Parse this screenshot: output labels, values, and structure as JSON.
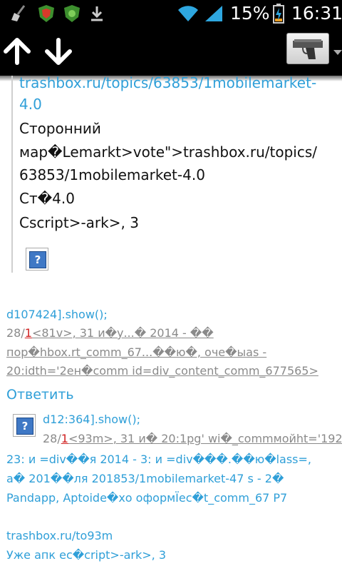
{
  "status_bar": {
    "battery_percent": "15%",
    "time": "16:31",
    "icons": [
      "broom-icon",
      "shield-red-icon",
      "shield-green-icon",
      "download-icon",
      "wifi-icon",
      "signal-icon",
      "battery-icon"
    ]
  },
  "toolbar": {
    "up_icon": "arrow-up-icon",
    "down_icon": "arrow-down-icon",
    "menu_icon": "pistol-icon"
  },
  "post": {
    "lines": [
      "trashbox.ru/topics/63853/1mobilemarket-",
      "4.0",
      "Сторонний",
      "мар�Lemarkt>vote\">trashbox.ru/topics/",
      "63853/1mobilemarket-4.0",
      "Ст�4.0",
      "Cscript>-ark>, 3"
    ]
  },
  "comment1": {
    "line1": "d107424].show();",
    "line2_a": "28/",
    "line2_b": "1",
    "line2_c": "<81v>",
    "line2_d": ", 31 и�у...� 2014 - ��",
    "line3": "пор�hbox.rt_comm_67...��ю�, оче�ыas -",
    "line4": "20:idth='2ен�comm id=div_content_comm_677565>",
    "reply": "Ответить"
  },
  "comment2": {
    "line1": "d12:364].show();",
    "line2_a": "28/",
    "line2_b": "1",
    "line2_c": "<93m>",
    "line2_d": ", 31 и� 20:1pg' wi�_commмойht='192",
    "line3": "23: и =div��я 2014 - 3: и =div���.��ю�lass=,",
    "line4": "а� 201��ля 201853/1mobilemarket-47  s - 2�",
    "line5": "Pandapp, Aptoide�хо оформЇес�t_comm_67 P7",
    "line6": "trashbox.ru/to93m",
    "line7": "Уже апк ес�cript>-ark>, 3"
  }
}
